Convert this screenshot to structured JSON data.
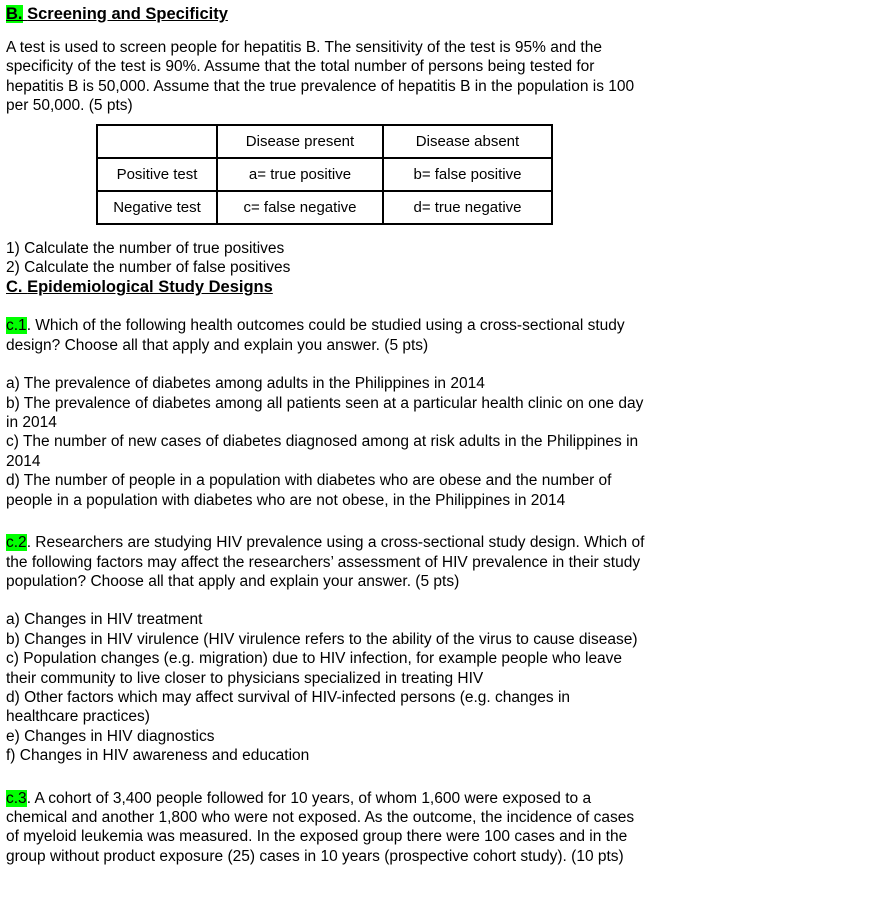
{
  "document": {
    "highlight_color": "#00ff00",
    "sections": {
      "b": {
        "label": "B.",
        "title": "Screening and Specificity",
        "intro": "A test is used to screen people for hepatitis B. The sensitivity of the test is 95% and the specificity of the test is 90%. Assume that the total number of persons being tested for hepatitis B is 50,000. Assume that the true prevalence of hepatitis B in the population is 100 per 50,000. (5 pts)",
        "table": {
          "corner": "",
          "column_headers": [
            "Disease present",
            "Disease absent"
          ],
          "rows": [
            {
              "header": "Positive test",
              "cells": [
                "a= true positive",
                "b= false positive"
              ]
            },
            {
              "header": "Negative test",
              "cells": [
                "c= false negative",
                "d= true negative"
              ]
            }
          ]
        },
        "tasks": [
          "1) Calculate the number of true positives",
          "2) Calculate the number of false positives"
        ]
      },
      "c": {
        "label": "C.",
        "title": "Epidemiological Study Designs",
        "questions": [
          {
            "number": "c.1",
            "after_number": ". Which of the following health outcomes could be studied using a cross-sectional study design? Choose all that apply and explain you answer. (5 pts)",
            "options": [
              "a) The prevalence of diabetes among adults in the Philippines in 2014",
              "b) The prevalence of diabetes among all patients seen at a particular health clinic on one day in 2014",
              "c) The number of new cases of diabetes diagnosed among at risk adults in the Philippines in 2014",
              "d) The number of people in a population with diabetes who are obese and the number of people in a population with diabetes who are not obese, in the Philippines in 2014"
            ]
          },
          {
            "number": "c.2",
            "after_number": ".  Researchers are studying HIV prevalence using a cross-sectional study design. Which of the following factors may affect the researchers’ assessment of HIV prevalence in their study population? Choose all that apply and explain your answer. (5 pts)",
            "options": [
              "a) Changes in HIV treatment",
              "b) Changes in HIV virulence (HIV virulence refers to the ability of the virus to cause disease)",
              "c) Population changes (e.g. migration) due to HIV infection, for example people who leave their community to live closer to physicians specialized in treating HIV",
              "d) Other factors which may affect survival of HIV-infected persons (e.g. changes in healthcare practices)",
              "e) Changes in HIV diagnostics",
              "f) Changes in HIV awareness and education"
            ]
          },
          {
            "number": "c.3",
            "after_number": ". A cohort of 3,400 people followed for 10 years, of whom 1,600 were exposed to a chemical and another 1,800 who were not exposed. As the outcome, the incidence of cases of myeloid leukemia was measured. In the exposed group there were 100 cases and in the group without product exposure (25) cases in 10 years (prospective cohort study). (10 pts)",
            "options": []
          }
        ]
      }
    }
  }
}
